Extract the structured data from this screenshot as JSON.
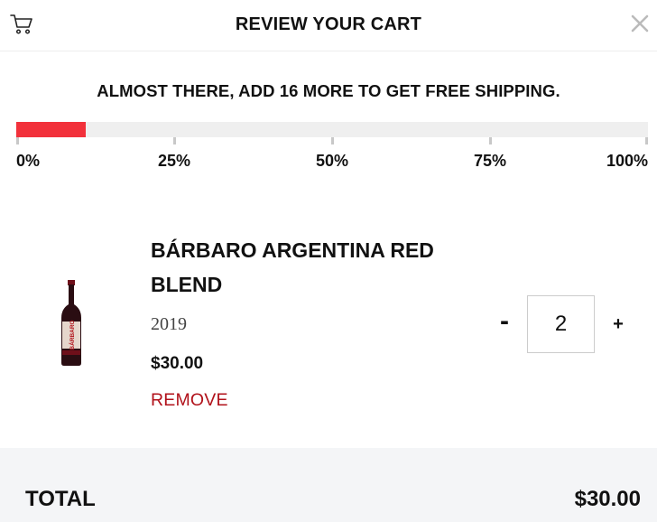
{
  "header": {
    "title": "REVIEW YOUR CART",
    "cart_icon": "shopping-cart-icon",
    "close_icon": "close-icon"
  },
  "shipping": {
    "message": "ALMOST THERE, ADD 16 MORE TO GET FREE SHIPPING.",
    "progress_fraction": 0.11,
    "ticks": [
      "0%",
      "25%",
      "50%",
      "75%",
      "100%"
    ],
    "fill_color": "#f2313b"
  },
  "cart_item": {
    "name": "BÁRBARO ARGENTINA RED BLEND",
    "vintage": "2019",
    "price": "$30.00",
    "remove_label": "REMOVE",
    "quantity": "2",
    "minus_label": "-",
    "plus_label": "+",
    "label_text": "BÁRBARO"
  },
  "summary": {
    "total_label": "TOTAL",
    "total_value": "$30.00"
  },
  "colors": {
    "accent_red": "#f2313b",
    "remove_red": "#b1121b",
    "footer_bg": "#f4f5f7"
  }
}
